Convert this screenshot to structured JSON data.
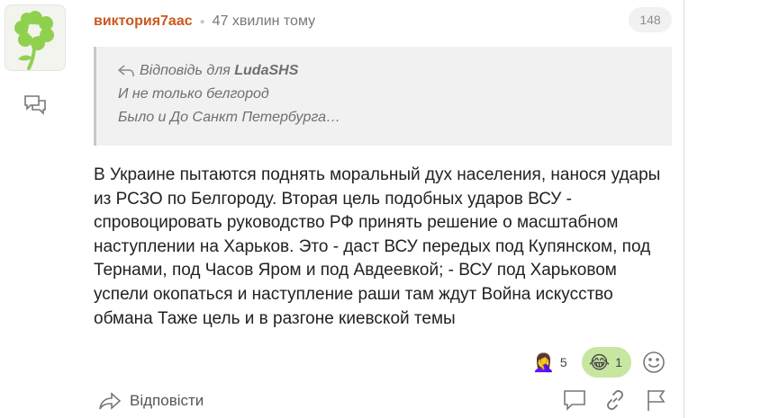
{
  "comment": {
    "username": "виктория7аас",
    "time_ago": "47 хвилин тому",
    "count": "148",
    "quote": {
      "reply_prefix": "Відповідь для",
      "reply_author": "LudaSHS",
      "lines": [
        "И не только белгород",
        "Было и До Санкт Петербурга…"
      ]
    },
    "text": "В Украине пытаются поднять моральный дух населения, нанося удары из РСЗО по Белгороду. Вторая цель подобных ударов ВСУ - спровоцировать руководство РФ принять решение о масштабном наступлении на Харьков. Это - даст ВСУ передых под Купянском, под Тернами, под Часов Яром и под Авдеевкой; - ВСУ под Харьковом успели окопаться и наступление раши там ждут Война искусство обмана Таже цель и в разгоне киевской темы",
    "reactions": [
      {
        "emoji": "🤦‍♀️",
        "count": "5"
      },
      {
        "emoji": "😂",
        "count": "1",
        "active": true
      }
    ],
    "reply_label": "Відповісти"
  },
  "colors": {
    "username": "#c85a1e",
    "active_reaction_bg": "#c7e6a0",
    "quote_bg": "#f1f1f1",
    "avatar_flower": "#8fd14f"
  },
  "icons": [
    "flower-avatar",
    "comment-icon",
    "reply-arrow-icon",
    "smiley-add-icon",
    "chat-bubble-icon",
    "link-icon",
    "flag-icon"
  ]
}
